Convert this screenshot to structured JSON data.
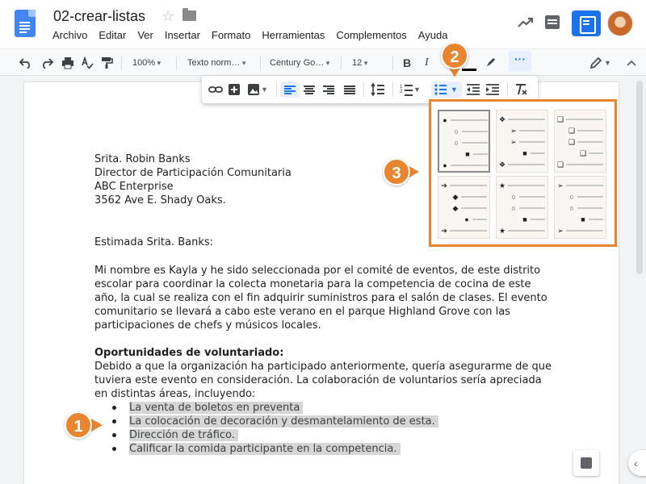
{
  "header": {
    "doc_title": "02-crear-listas",
    "menus": [
      "Archivo",
      "Editar",
      "Ver",
      "Insertar",
      "Formato",
      "Herramientas",
      "Complementos",
      "Ayuda"
    ]
  },
  "toolbar": {
    "zoom": "100%",
    "style": "Texto norm…",
    "font": "Century Go…",
    "size": "12",
    "bold": "B",
    "italic": "I",
    "more": "···"
  },
  "document": {
    "address": [
      "Srita. Robin Banks",
      "Director de Participación Comunitaria",
      "ABC Enterprise",
      "3562 Ave E. Shady Oaks."
    ],
    "salutation": "Estimada Srita. Banks:",
    "paragraph": "Mi nombre es Kayla y he sido seleccionada por el comité de eventos, de este distrito escolar para coordinar la colecta monetaria para la competencia de cocina de este año, la cual se realiza con el fin adquirir suministros para el salón de clases. El evento comunitario se llevará a cabo este verano en el parque Highland Grove con las participaciones de chefs y músicos locales.",
    "volunteer_heading": "Oportunidades de voluntariado:",
    "volunteer_text": "Debido a que la organización ha participado anteriormente, quería asegurarme de que tuviera este evento en consideración. La colaboración de voluntarios sería apreciada en distintas áreas, incluyendo:",
    "list_items": [
      "La venta de boletos en preventa",
      "La colocación de decoración y desmantelamiento de esta.",
      "Dirección de tráfico.",
      "Calificar la comida participante en la competencia."
    ]
  },
  "callouts": [
    "1",
    "2",
    "3"
  ],
  "colors": {
    "accent": "#e8852e",
    "blue": "#1a73e8"
  }
}
